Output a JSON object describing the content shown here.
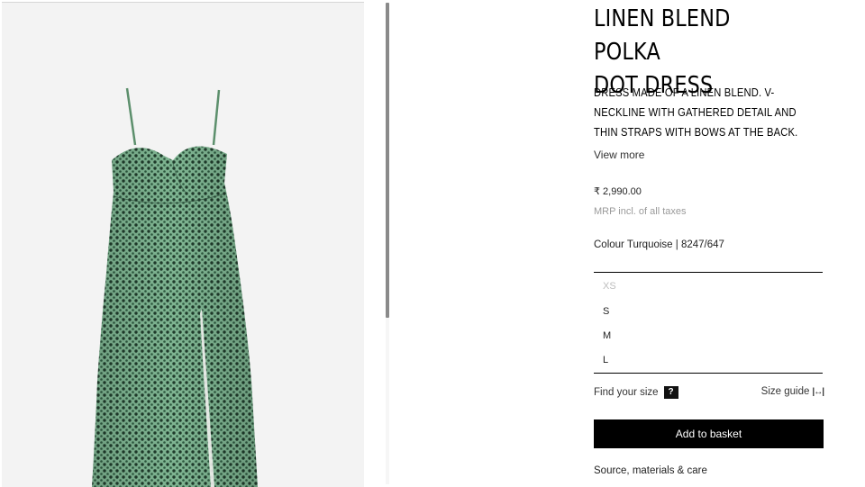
{
  "product": {
    "title": "LINEN BLEND POLKA\nDOT DRESS",
    "description": "DRESS MADE OF A LINEN BLEND. V-NECKLINE WITH GATHERED DETAIL AND THIN STRAPS WITH BOWS AT THE BACK.",
    "view_more": "View more",
    "price": "₹ 2,990.00",
    "tax_note": "MRP incl. of all taxes",
    "colour": "Colour Turquoise | 8247/647",
    "sizes": [
      {
        "label": "XS",
        "available": false
      },
      {
        "label": "S",
        "available": true
      },
      {
        "label": "M",
        "available": true
      },
      {
        "label": "L",
        "available": true
      }
    ],
    "find_size_label": "Find your size",
    "find_size_icon": "?",
    "size_guide_label": "Size guide",
    "size_guide_icon": "|↔|",
    "add_to_basket": "Add to basket",
    "source_label": "Source, materials & care"
  },
  "colors": {
    "dress_green": "#6fa583",
    "dot_color": "#1f3b2b",
    "image_background": "#f3f3f3"
  }
}
